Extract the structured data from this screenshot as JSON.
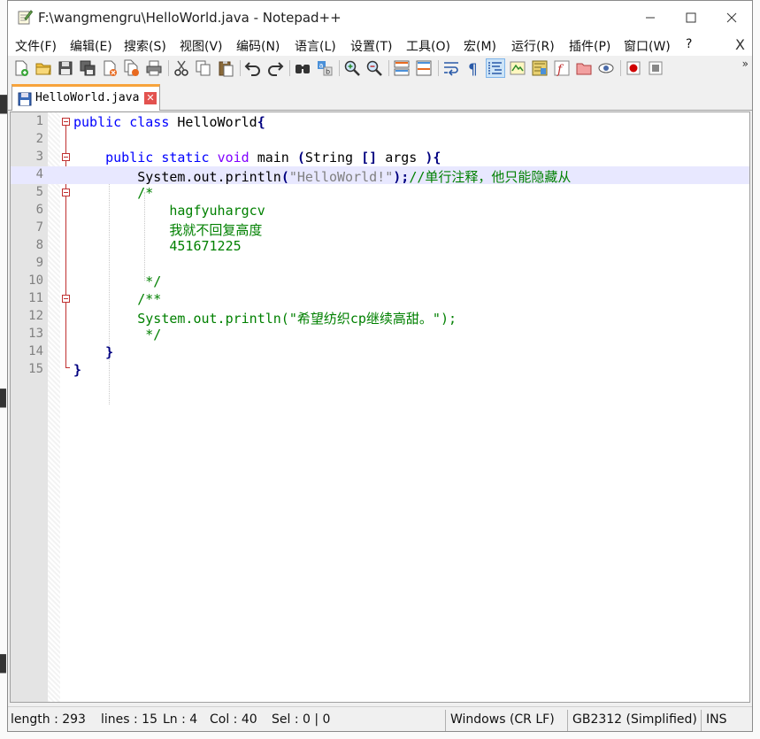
{
  "window": {
    "title": "F:\\wangmengru\\HelloWorld.java - Notepad++"
  },
  "menu": {
    "items": [
      "文件(F)",
      "编辑(E)",
      "搜索(S)",
      "视图(V)",
      "编码(N)",
      "语言(L)",
      "设置(T)",
      "工具(O)",
      "宏(M)",
      "运行(R)",
      "插件(P)",
      "窗口(W)",
      "?"
    ],
    "close": "X"
  },
  "toolbar": {
    "icons": [
      "new-file-icon",
      "open-file-icon",
      "save-icon",
      "save-all-icon",
      "close-icon",
      "close-all-icon",
      "print-icon",
      "cut-icon",
      "copy-icon",
      "paste-icon",
      "undo-icon",
      "redo-icon",
      "find-icon",
      "replace-icon",
      "zoom-in-icon",
      "zoom-out-icon",
      "sync-vertical-icon",
      "sync-horizontal-icon",
      "word-wrap-icon",
      "show-all-chars-icon",
      "indent-guide-icon",
      "udl-icon",
      "doc-map-icon",
      "function-list-icon",
      "folder-workspace-icon",
      "monitor-icon",
      "record-macro-icon",
      "stop-record-icon"
    ],
    "more": "»"
  },
  "tab": {
    "label": "HelloWorld.java",
    "close": "✕"
  },
  "editor": {
    "lines": [
      {
        "n": "1",
        "segs": [
          {
            "c": "kw",
            "t": "public class "
          },
          {
            "c": "",
            "t": "HelloWorld"
          },
          {
            "c": "op",
            "t": "{"
          }
        ]
      },
      {
        "n": "2",
        "segs": []
      },
      {
        "n": "3",
        "segs": [
          {
            "c": "",
            "t": "    "
          },
          {
            "c": "kw",
            "t": "public static "
          },
          {
            "c": "typ",
            "t": "void "
          },
          {
            "c": "",
            "t": "main "
          },
          {
            "c": "op",
            "t": "("
          },
          {
            "c": "",
            "t": "String "
          },
          {
            "c": "op",
            "t": "[]"
          },
          {
            "c": "",
            "t": " args "
          },
          {
            "c": "op",
            "t": "){"
          }
        ]
      },
      {
        "n": "4",
        "segs": [
          {
            "c": "",
            "t": "        System.out.println"
          },
          {
            "c": "op",
            "t": "("
          },
          {
            "c": "str",
            "t": "\"HelloWorld!\""
          },
          {
            "c": "op",
            "t": ");"
          },
          {
            "c": "cmt",
            "t": "//单行注释，他只能隐藏从"
          }
        ]
      },
      {
        "n": "5",
        "segs": [
          {
            "c": "cmt",
            "t": "        /*"
          }
        ]
      },
      {
        "n": "6",
        "segs": [
          {
            "c": "cmt",
            "t": "            hagfyuhargcv"
          }
        ]
      },
      {
        "n": "7",
        "segs": [
          {
            "c": "cmt",
            "t": "            我就不回复高度"
          }
        ]
      },
      {
        "n": "8",
        "segs": [
          {
            "c": "cmt",
            "t": "            451671225"
          }
        ]
      },
      {
        "n": "9",
        "segs": []
      },
      {
        "n": "10",
        "segs": [
          {
            "c": "cmt",
            "t": "         */"
          }
        ]
      },
      {
        "n": "11",
        "segs": [
          {
            "c": "cmt",
            "t": "        /**"
          }
        ]
      },
      {
        "n": "12",
        "segs": [
          {
            "c": "cmt",
            "t": "        System.out.println(\"希望纺织cp继续高甜。\");"
          }
        ]
      },
      {
        "n": "13",
        "segs": [
          {
            "c": "cmt",
            "t": "         */"
          }
        ]
      },
      {
        "n": "14",
        "segs": [
          {
            "c": "op",
            "t": "    }"
          }
        ]
      },
      {
        "n": "15",
        "segs": [
          {
            "c": "op",
            "t": "}"
          }
        ]
      }
    ],
    "current_line": 4
  },
  "status": {
    "length": "length : 293",
    "lines": "lines : 15",
    "ln": "Ln : 4",
    "col": "Col : 40",
    "sel": "Sel : 0 | 0",
    "eol": "Windows (CR LF)",
    "encoding": "GB2312 (Simplified)",
    "mode": "INS"
  },
  "colors": {
    "keyword": "#0000ff",
    "type": "#8000ff",
    "string": "#808080",
    "comment": "#008000",
    "operator": "#000080",
    "current_line": "#e8e8ff",
    "tab_accent": "#f7a33b"
  }
}
